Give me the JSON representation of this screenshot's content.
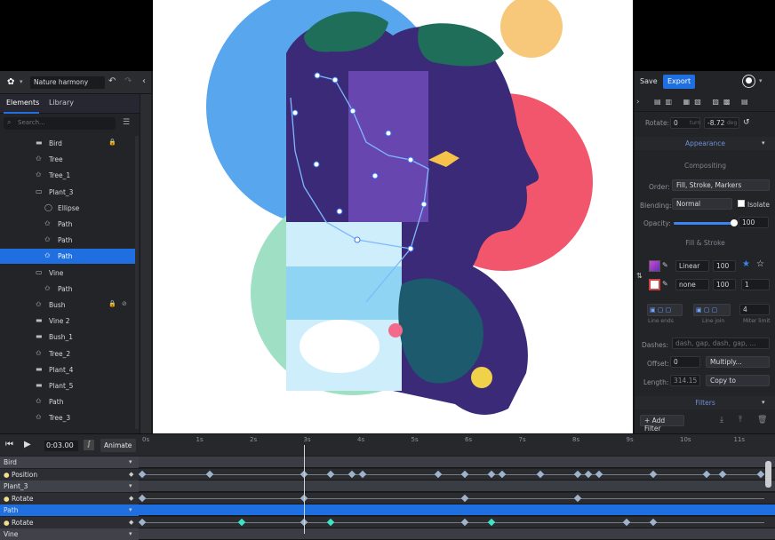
{
  "topbar": {
    "doc_name": "Nature harmony"
  },
  "elements_panel": {
    "tabs": [
      "Elements",
      "Library"
    ],
    "search_placeholder": "Search...",
    "items": [
      {
        "label": "Bird",
        "icon": "folder-icon",
        "indent": 1,
        "locked": true
      },
      {
        "label": "Tree",
        "icon": "star-icon",
        "indent": 1
      },
      {
        "label": "Tree_1",
        "icon": "star-icon",
        "indent": 1
      },
      {
        "label": "Plant_3",
        "icon": "folder-open-icon",
        "indent": 1
      },
      {
        "label": "Ellipse",
        "icon": "ellipse-icon",
        "indent": 2
      },
      {
        "label": "Path",
        "icon": "star-icon",
        "indent": 2
      },
      {
        "label": "Path",
        "icon": "star-icon",
        "indent": 2
      },
      {
        "label": "Path",
        "icon": "star-icon",
        "indent": 2,
        "selected": true
      },
      {
        "label": "Vine",
        "icon": "folder-open-icon",
        "indent": 1
      },
      {
        "label": "Path",
        "icon": "star-icon",
        "indent": 2
      },
      {
        "label": "Bush",
        "icon": "star-icon",
        "indent": 1,
        "locked": true,
        "hidden": true
      },
      {
        "label": "Vine 2",
        "icon": "folder-icon",
        "indent": 1
      },
      {
        "label": "Bush_1",
        "icon": "folder-icon",
        "indent": 1
      },
      {
        "label": "Tree_2",
        "icon": "star-icon",
        "indent": 1
      },
      {
        "label": "Plant_4",
        "icon": "folder-icon",
        "indent": 1
      },
      {
        "label": "Plant_5",
        "icon": "folder-icon",
        "indent": 1
      },
      {
        "label": "Path",
        "icon": "star-icon",
        "indent": 1
      },
      {
        "label": "Tree_3",
        "icon": "star-icon",
        "indent": 1
      }
    ]
  },
  "right_panel": {
    "save": "Save",
    "export": "Export",
    "rotate_label": "Rotate:",
    "rotate_value": "0",
    "rotate_unit": "turn",
    "rotate_deg": "-8.72",
    "rotate_deg_unit": "deg",
    "appearance": "Appearance",
    "compositing": "Compositing",
    "order_label": "Order:",
    "order_value": "Fill, Stroke, Markers",
    "blending_label": "Blending:",
    "blending_value": "Normal",
    "isolate": "Isolate",
    "opacity_label": "Opacity:",
    "opacity_value": "100",
    "opacity_fraction": 1.0,
    "fill_stroke": "Fill & Stroke",
    "fill_type": "Linear",
    "fill_pct": "100",
    "stroke_type": "none",
    "stroke_pct": "100",
    "stroke_width": "1",
    "line_ends": "Line ends",
    "line_join": "Line join",
    "miter_value": "4",
    "miter_label": "Miter limit",
    "dashes_label": "Dashes:",
    "dashes_placeholder": "dash, gap, dash, gap, ...",
    "offset_label": "Offset:",
    "offset_value": "0",
    "offset_mode": "Multiply...",
    "length_label": "Length:",
    "length_value": "314.15",
    "length_mode": "Copy to",
    "filters": "Filters",
    "add_filter": "+ Add Filter"
  },
  "timeline": {
    "time": "0:03.00",
    "animate": "Animate",
    "ticks": [
      "0s",
      "1s",
      "2s",
      "3s",
      "4s",
      "5s",
      "6s",
      "7s",
      "8s",
      "9s",
      "10s",
      "11s"
    ],
    "playhead_seconds": 3,
    "rows": [
      {
        "label": "Bird",
        "type": "group"
      },
      {
        "label": "Position",
        "type": "prop",
        "keys": [
          0,
          1.25,
          3,
          3.5,
          3.9,
          4.1,
          5.5,
          6,
          6.5,
          6.7,
          7.4,
          8.1,
          8.3,
          8.5,
          9.5,
          10.5,
          10.8,
          11.5
        ]
      },
      {
        "label": "Plant_3",
        "type": "group"
      },
      {
        "label": "Rotate",
        "type": "prop",
        "keys": [
          0,
          3,
          6,
          8.1
        ]
      },
      {
        "label": "Path",
        "type": "group",
        "selected": true
      },
      {
        "label": "Rotate",
        "type": "prop",
        "keys": [
          0,
          1.85,
          3,
          3.5,
          6,
          6.5,
          9,
          9.5
        ],
        "teal": [
          1.85,
          3.5,
          6.5
        ]
      },
      {
        "label": "Vine",
        "type": "group"
      }
    ]
  },
  "colors": {
    "accent": "#1f6fe0",
    "selection": "#1f6fe0",
    "keyframe_teal": "#3fe3c8"
  }
}
